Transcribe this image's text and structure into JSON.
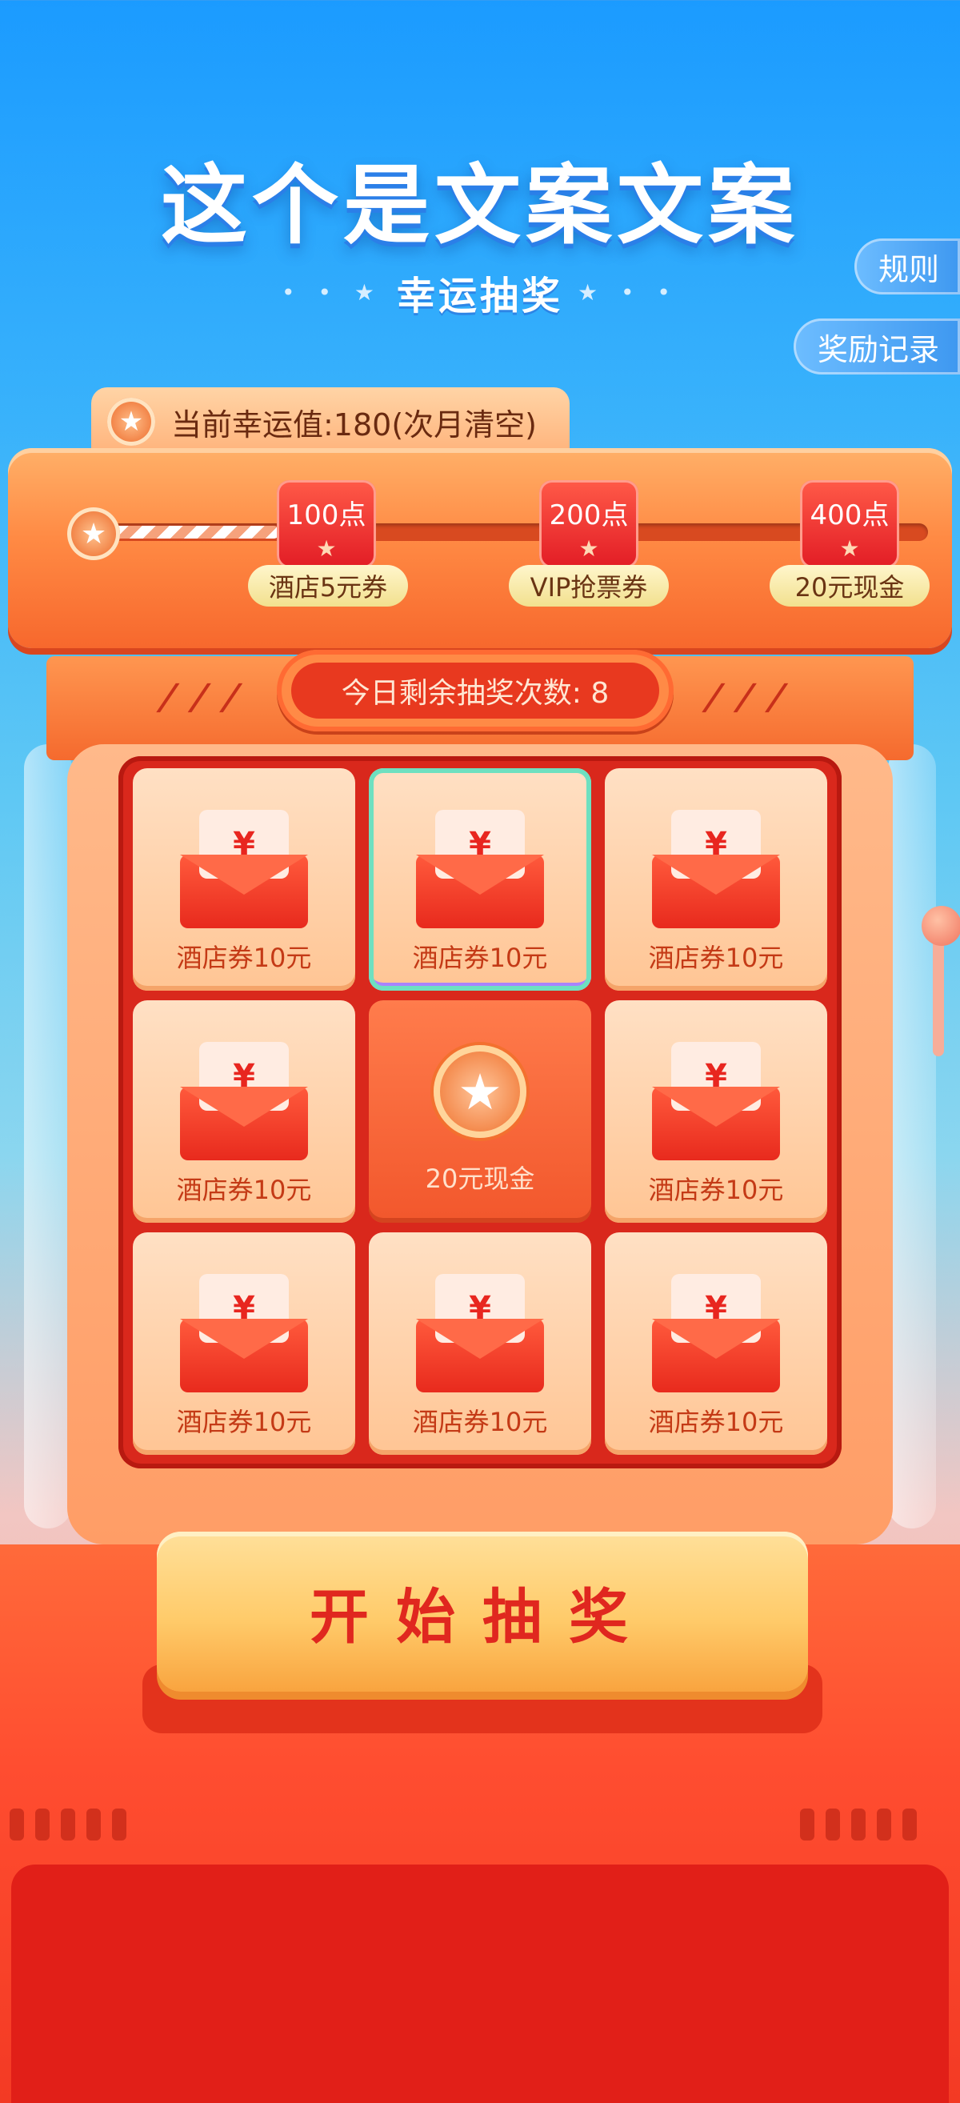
{
  "header": {
    "title": "这个是文案文案",
    "subtitle": "幸运抽奖",
    "rules_button": "规则",
    "records_button": "奖励记录"
  },
  "luck": {
    "label": "当前幸运值:180(次月清空)"
  },
  "progress": {
    "milestones": [
      {
        "points": "100点",
        "reward": "酒店5元券"
      },
      {
        "points": "200点",
        "reward": "VIP抢票券"
      },
      {
        "points": "400点",
        "reward": "20元现金"
      }
    ]
  },
  "draw": {
    "remaining_label": "今日剩余抽奖次数: 8",
    "start_button": "开始抽奖"
  },
  "grid": {
    "cells": [
      {
        "label": "酒店券10元",
        "icon": "red-envelope-icon"
      },
      {
        "label": "酒店券10元",
        "icon": "red-envelope-icon",
        "selected": true
      },
      {
        "label": "酒店券10元",
        "icon": "red-envelope-icon"
      },
      {
        "label": "酒店券10元",
        "icon": "red-envelope-icon"
      },
      {
        "label": "20元现金",
        "icon": "star-coin-icon"
      },
      {
        "label": "酒店券10元",
        "icon": "red-envelope-icon"
      },
      {
        "label": "酒店券10元",
        "icon": "red-envelope-icon"
      },
      {
        "label": "酒店券10元",
        "icon": "red-envelope-icon"
      },
      {
        "label": "酒店券10元",
        "icon": "red-envelope-icon"
      }
    ]
  },
  "icons": {
    "yuan_glyph": "¥",
    "star_glyph": "★"
  },
  "colors": {
    "accent": "#e0271f",
    "machine": "#ff6a3a",
    "button": "#ffcb6a"
  }
}
